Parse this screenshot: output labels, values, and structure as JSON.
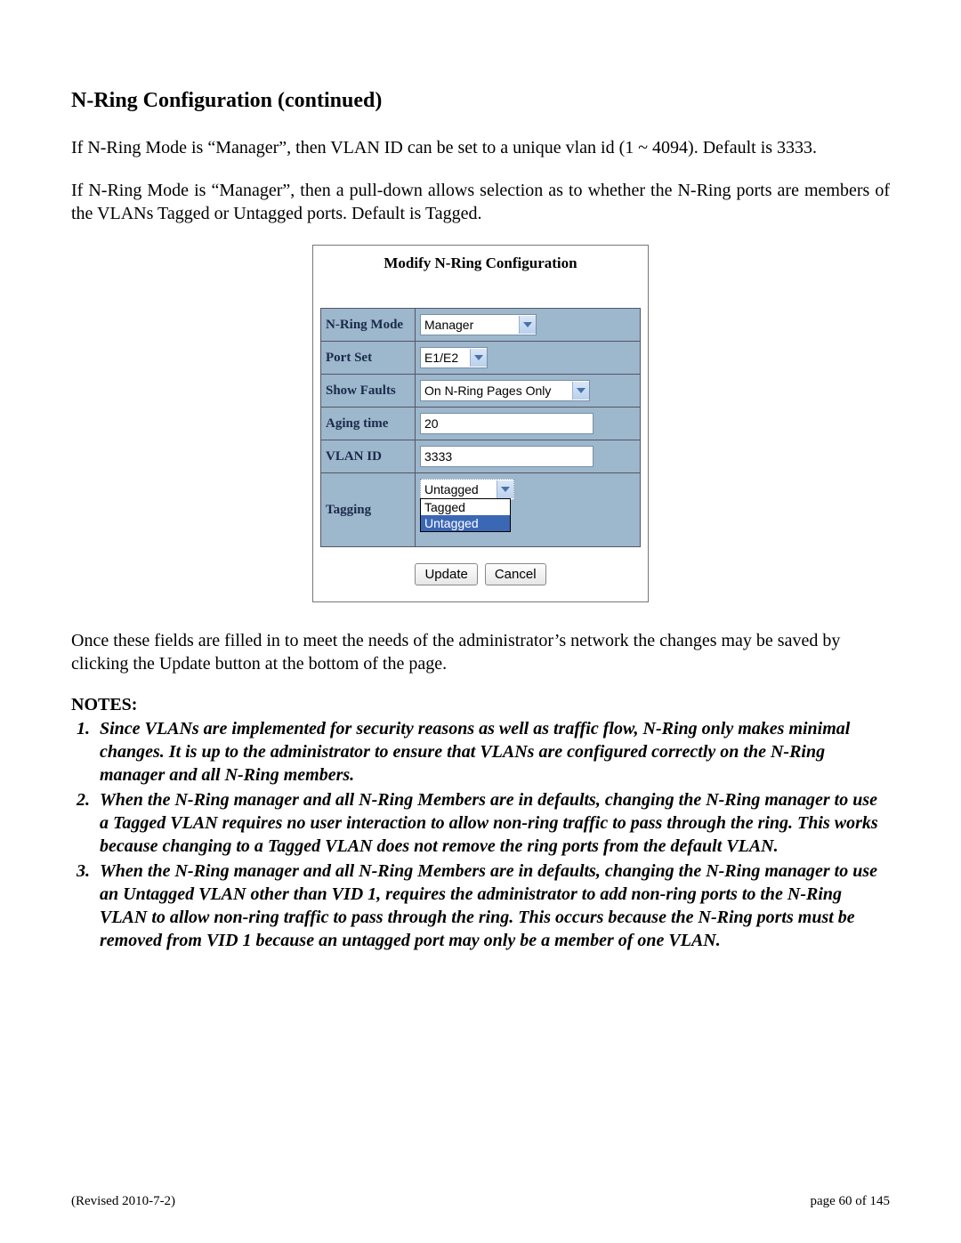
{
  "title": "N-Ring Configuration (continued)",
  "para1": "If N-Ring Mode is “Manager”, then VLAN ID can be set to a unique vlan id (1 ~ 4094). Default is 3333.",
  "para2": "If N-Ring Mode is “Manager”, then a pull-down allows selection as to whether the N-Ring ports are members of the VLANs Tagged or Untagged ports.  Default is Tagged.",
  "panel": {
    "title": "Modify N-Ring Configuration",
    "rows": {
      "mode": {
        "label": "N-Ring Mode",
        "value": "Manager"
      },
      "portset": {
        "label": "Port Set",
        "value": "E1/E2"
      },
      "show": {
        "label": "Show Faults",
        "value": "On N-Ring Pages Only"
      },
      "aging": {
        "label": "Aging time",
        "value": "20"
      },
      "vlan": {
        "label": "VLAN ID",
        "value": "3333"
      },
      "tagging": {
        "label": "Tagging",
        "value": "Untagged",
        "options": {
          "opt1": "Tagged",
          "opt2": "Untagged"
        }
      }
    },
    "buttons": {
      "update": "Update",
      "cancel": "Cancel"
    }
  },
  "para3": "Once these fields are filled in to meet the needs of the administrator’s network the changes may be saved by clicking the Update button at the bottom of the page.",
  "notes_heading": "NOTES:",
  "notes": {
    "n1": "Since VLANs are implemented for security reasons as well as traffic flow, N-Ring only makes minimal changes.  It is up to the administrator to ensure that VLANs are configured correctly on the N-Ring manager and all N-Ring members.",
    "n2": "When the N-Ring manager and all N-Ring Members are in defaults, changing the N-Ring manager to use a Tagged VLAN requires no user interaction to allow non-ring traffic to pass through the ring.  This works because changing to a Tagged VLAN does not remove the ring ports from the default VLAN.",
    "n3": "When the N-Ring manager and all N-Ring Members are in defaults, changing the N-Ring manager to use an Untagged VLAN other than VID 1, requires the administrator to add non-ring ports to the N-Ring VLAN to allow non-ring traffic to pass through the ring.  This occurs because the N-Ring ports must be removed from VID 1 because an untagged port may only be a member of one VLAN."
  },
  "footer": {
    "left": "(Revised 2010-7-2)",
    "right": "page 60 of 145"
  }
}
